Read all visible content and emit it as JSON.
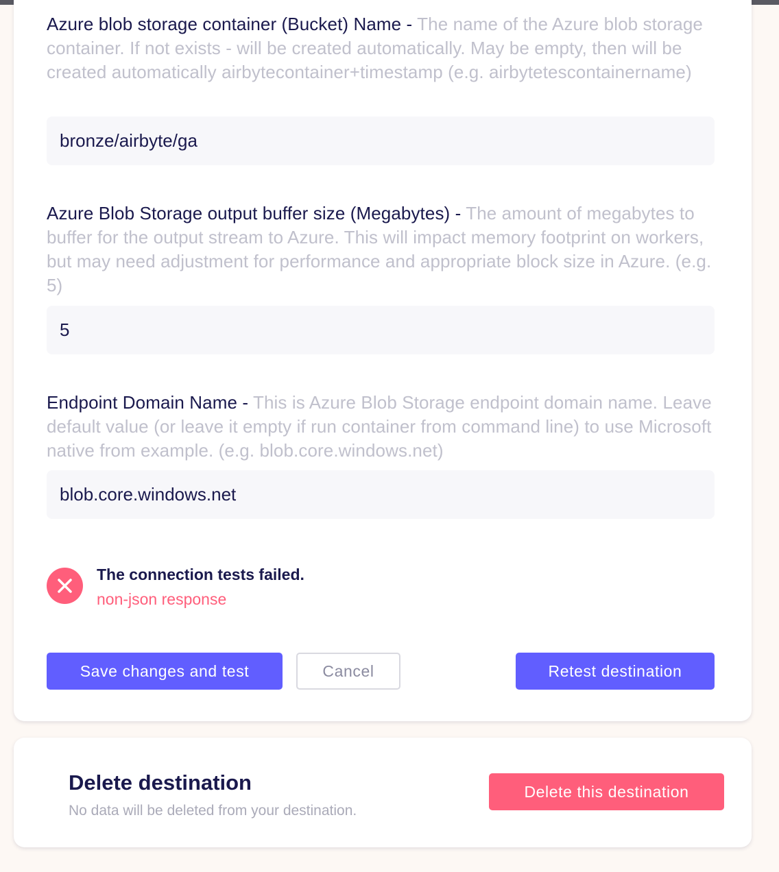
{
  "form": {
    "fields": [
      {
        "title": "Azure blob storage container (Bucket) Name",
        "separator": " - ",
        "description": "The name of the Azure blob storage container. If not exists - will be created automatically. May be empty, then will be created automatically airbytecontainer+timestamp (e.g. airbytetescontainername)",
        "value": "bronze/airbyte/ga"
      },
      {
        "title": "Azure Blob Storage output buffer size (Megabytes)",
        "separator": " - ",
        "description": "The amount of megabytes to buffer for the output stream to Azure. This will impact memory footprint on workers, but may need adjustment for performance and appropriate block size in Azure. (e.g. 5)",
        "value": "5"
      },
      {
        "title": "Endpoint Domain Name",
        "separator": " - ",
        "description": "This is Azure Blob Storage endpoint domain name. Leave default value (or leave it empty if run container from command line) to use Microsoft native from example. (e.g. blob.core.windows.net)",
        "value": "blob.core.windows.net"
      }
    ],
    "error": {
      "title": "The connection tests failed.",
      "message": "non-json response",
      "icon": "close-icon"
    },
    "buttons": {
      "save": "Save changes and test",
      "cancel": "Cancel",
      "retest": "Retest destination"
    }
  },
  "delete_section": {
    "title": "Delete destination",
    "subtitle": "No data will be deleted from your destination.",
    "button": "Delete this destination"
  },
  "colors": {
    "primary": "#615eff",
    "danger": "#ff5e7b",
    "text_dark": "#1a194d",
    "text_muted": "#c0c0cc"
  }
}
